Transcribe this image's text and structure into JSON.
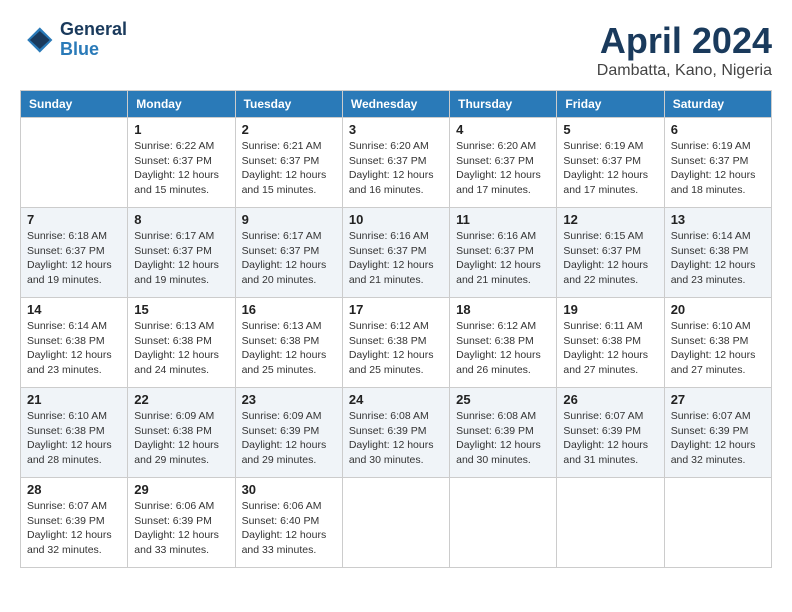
{
  "header": {
    "logo": {
      "line1": "General",
      "line2": "Blue"
    },
    "title": "April 2024",
    "location": "Dambatta, Kano, Nigeria"
  },
  "weekdays": [
    "Sunday",
    "Monday",
    "Tuesday",
    "Wednesday",
    "Thursday",
    "Friday",
    "Saturday"
  ],
  "weeks": [
    [
      {
        "day": "",
        "info": ""
      },
      {
        "day": "1",
        "info": "Sunrise: 6:22 AM\nSunset: 6:37 PM\nDaylight: 12 hours\nand 15 minutes."
      },
      {
        "day": "2",
        "info": "Sunrise: 6:21 AM\nSunset: 6:37 PM\nDaylight: 12 hours\nand 15 minutes."
      },
      {
        "day": "3",
        "info": "Sunrise: 6:20 AM\nSunset: 6:37 PM\nDaylight: 12 hours\nand 16 minutes."
      },
      {
        "day": "4",
        "info": "Sunrise: 6:20 AM\nSunset: 6:37 PM\nDaylight: 12 hours\nand 17 minutes."
      },
      {
        "day": "5",
        "info": "Sunrise: 6:19 AM\nSunset: 6:37 PM\nDaylight: 12 hours\nand 17 minutes."
      },
      {
        "day": "6",
        "info": "Sunrise: 6:19 AM\nSunset: 6:37 PM\nDaylight: 12 hours\nand 18 minutes."
      }
    ],
    [
      {
        "day": "7",
        "info": "Sunrise: 6:18 AM\nSunset: 6:37 PM\nDaylight: 12 hours\nand 19 minutes."
      },
      {
        "day": "8",
        "info": "Sunrise: 6:17 AM\nSunset: 6:37 PM\nDaylight: 12 hours\nand 19 minutes."
      },
      {
        "day": "9",
        "info": "Sunrise: 6:17 AM\nSunset: 6:37 PM\nDaylight: 12 hours\nand 20 minutes."
      },
      {
        "day": "10",
        "info": "Sunrise: 6:16 AM\nSunset: 6:37 PM\nDaylight: 12 hours\nand 21 minutes."
      },
      {
        "day": "11",
        "info": "Sunrise: 6:16 AM\nSunset: 6:37 PM\nDaylight: 12 hours\nand 21 minutes."
      },
      {
        "day": "12",
        "info": "Sunrise: 6:15 AM\nSunset: 6:37 PM\nDaylight: 12 hours\nand 22 minutes."
      },
      {
        "day": "13",
        "info": "Sunrise: 6:14 AM\nSunset: 6:38 PM\nDaylight: 12 hours\nand 23 minutes."
      }
    ],
    [
      {
        "day": "14",
        "info": "Sunrise: 6:14 AM\nSunset: 6:38 PM\nDaylight: 12 hours\nand 23 minutes."
      },
      {
        "day": "15",
        "info": "Sunrise: 6:13 AM\nSunset: 6:38 PM\nDaylight: 12 hours\nand 24 minutes."
      },
      {
        "day": "16",
        "info": "Sunrise: 6:13 AM\nSunset: 6:38 PM\nDaylight: 12 hours\nand 25 minutes."
      },
      {
        "day": "17",
        "info": "Sunrise: 6:12 AM\nSunset: 6:38 PM\nDaylight: 12 hours\nand 25 minutes."
      },
      {
        "day": "18",
        "info": "Sunrise: 6:12 AM\nSunset: 6:38 PM\nDaylight: 12 hours\nand 26 minutes."
      },
      {
        "day": "19",
        "info": "Sunrise: 6:11 AM\nSunset: 6:38 PM\nDaylight: 12 hours\nand 27 minutes."
      },
      {
        "day": "20",
        "info": "Sunrise: 6:10 AM\nSunset: 6:38 PM\nDaylight: 12 hours\nand 27 minutes."
      }
    ],
    [
      {
        "day": "21",
        "info": "Sunrise: 6:10 AM\nSunset: 6:38 PM\nDaylight: 12 hours\nand 28 minutes."
      },
      {
        "day": "22",
        "info": "Sunrise: 6:09 AM\nSunset: 6:38 PM\nDaylight: 12 hours\nand 29 minutes."
      },
      {
        "day": "23",
        "info": "Sunrise: 6:09 AM\nSunset: 6:39 PM\nDaylight: 12 hours\nand 29 minutes."
      },
      {
        "day": "24",
        "info": "Sunrise: 6:08 AM\nSunset: 6:39 PM\nDaylight: 12 hours\nand 30 minutes."
      },
      {
        "day": "25",
        "info": "Sunrise: 6:08 AM\nSunset: 6:39 PM\nDaylight: 12 hours\nand 30 minutes."
      },
      {
        "day": "26",
        "info": "Sunrise: 6:07 AM\nSunset: 6:39 PM\nDaylight: 12 hours\nand 31 minutes."
      },
      {
        "day": "27",
        "info": "Sunrise: 6:07 AM\nSunset: 6:39 PM\nDaylight: 12 hours\nand 32 minutes."
      }
    ],
    [
      {
        "day": "28",
        "info": "Sunrise: 6:07 AM\nSunset: 6:39 PM\nDaylight: 12 hours\nand 32 minutes."
      },
      {
        "day": "29",
        "info": "Sunrise: 6:06 AM\nSunset: 6:39 PM\nDaylight: 12 hours\nand 33 minutes."
      },
      {
        "day": "30",
        "info": "Sunrise: 6:06 AM\nSunset: 6:40 PM\nDaylight: 12 hours\nand 33 minutes."
      },
      {
        "day": "",
        "info": ""
      },
      {
        "day": "",
        "info": ""
      },
      {
        "day": "",
        "info": ""
      },
      {
        "day": "",
        "info": ""
      }
    ]
  ]
}
